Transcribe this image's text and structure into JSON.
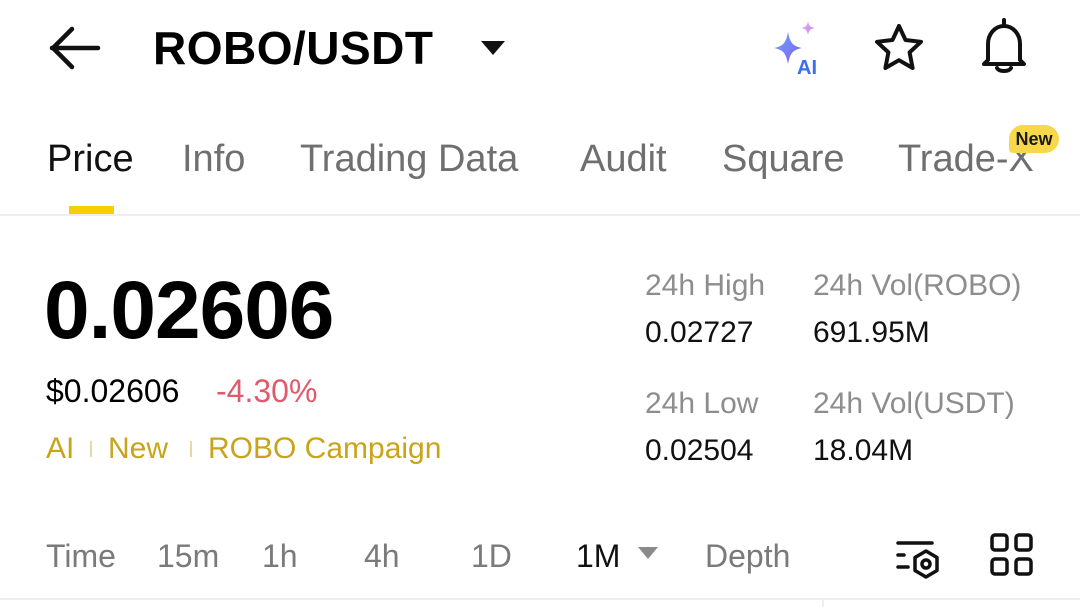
{
  "header": {
    "pair": "ROBO/USDT",
    "ai_icon_text": "AI"
  },
  "tabs": [
    {
      "label": "Price",
      "active": true
    },
    {
      "label": "Info"
    },
    {
      "label": "Trading Data"
    },
    {
      "label": "Audit"
    },
    {
      "label": "Square"
    },
    {
      "label": "Trade-X",
      "badge": "New"
    }
  ],
  "price": {
    "last": "0.02606",
    "usd": "$0.02606",
    "change": "-4.30%"
  },
  "tags": [
    "AI",
    "New",
    "ROBO Campaign"
  ],
  "stats": {
    "high_label": "24h High",
    "high_value": "0.02727",
    "vol_base_label": "24h Vol(ROBO)",
    "vol_base_value": "691.95M",
    "low_label": "24h Low",
    "low_value": "0.02504",
    "vol_quote_label": "24h Vol(USDT)",
    "vol_quote_value": "18.04M"
  },
  "timeframes": {
    "label": "Time",
    "options": [
      "15m",
      "1h",
      "4h",
      "1D",
      "1M",
      "Depth"
    ],
    "selected": "1M"
  },
  "icons": {
    "back": "arrow-left-icon",
    "caret": "caret-down-icon",
    "ai": "sparkle-ai-icon",
    "favorite": "star-icon",
    "alert": "bell-icon",
    "chart_settings": "chart-settings-icon",
    "layout": "grid-icon"
  },
  "colors": {
    "accent": "#f5d000",
    "negative": "#e05a6b",
    "tag": "#c9a41a",
    "muted": "#8d8d8d"
  }
}
